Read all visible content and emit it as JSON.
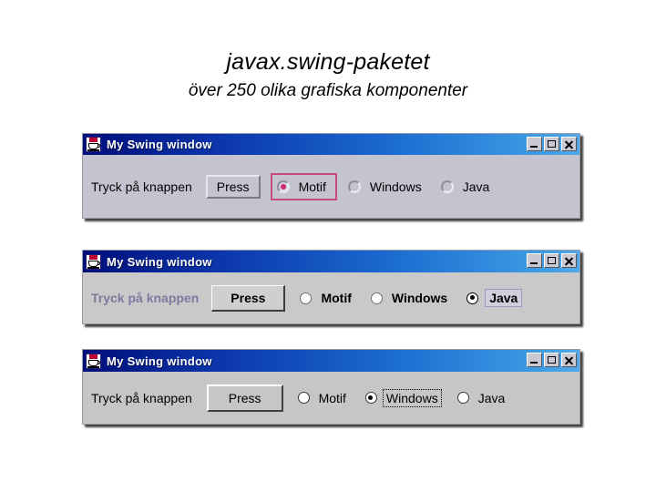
{
  "heading": {
    "title": "javax.swing-paketet",
    "subtitle": "över 250 olika grafiska komponenter"
  },
  "colors": {
    "titlebar_left": "#000e7a",
    "titlebar_right": "#4fa9ea",
    "panel_motif": "#c4c4d0",
    "panel_metal": "#c9c9c9",
    "panel_windows": "#c6c6c6",
    "motif_accent": "#cc2a72",
    "motif_focus_border": "#c9487e",
    "metal_label": "#7b7ba0",
    "metal_focus_border": "#9a9ac4"
  },
  "window_buttons": {
    "minimize": "minimize-icon",
    "maximize": "maximize-icon",
    "close": "close-icon"
  },
  "windows": [
    {
      "look_and_feel": "Motif",
      "title": "My Swing window",
      "icon": "java-coffee-cup-icon",
      "label": "Tryck på knappen",
      "button": "Press",
      "radios": [
        {
          "label": "Motif",
          "selected": true,
          "focused": true
        },
        {
          "label": "Windows",
          "selected": false,
          "focused": false
        },
        {
          "label": "Java",
          "selected": false,
          "focused": false
        }
      ]
    },
    {
      "look_and_feel": "Metal",
      "title": "My Swing window",
      "icon": "java-coffee-cup-icon",
      "label": "Tryck på knappen",
      "button": "Press",
      "radios": [
        {
          "label": "Motif",
          "selected": false,
          "focused": false
        },
        {
          "label": "Windows",
          "selected": false,
          "focused": false
        },
        {
          "label": "Java",
          "selected": true,
          "focused": true
        }
      ]
    },
    {
      "look_and_feel": "Windows",
      "title": "My Swing window",
      "icon": "java-coffee-cup-icon",
      "label": "Tryck på knappen",
      "button": "Press",
      "radios": [
        {
          "label": "Motif",
          "selected": false,
          "focused": false
        },
        {
          "label": "Windows",
          "selected": true,
          "focused": true
        },
        {
          "label": "Java",
          "selected": false,
          "focused": false
        }
      ]
    }
  ]
}
